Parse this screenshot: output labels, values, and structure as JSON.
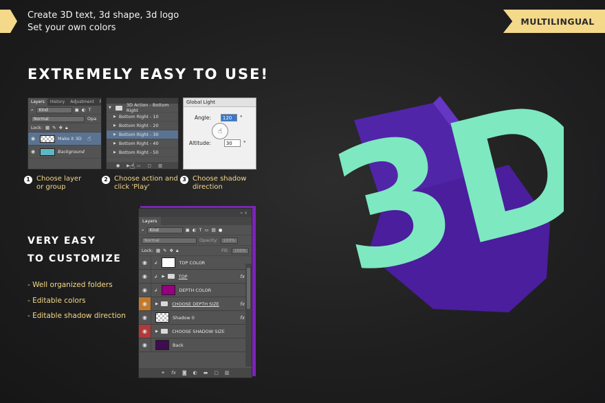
{
  "header": {
    "line1": "Create 3D text, 3d shape, 3d logo",
    "line2": "Set your own colors",
    "badge": "MULTILINGUAL"
  },
  "headline": "EXTREMELY EASY TO USE!",
  "panel_layers_small": {
    "tabs": [
      "Layers",
      "History",
      "Adjustment",
      "P"
    ],
    "kind": "Kind",
    "blend": "Normal",
    "opacity_label": "Opa",
    "lock_label": "Lock:",
    "layers": [
      "Make it 3D",
      "Background"
    ]
  },
  "panel_actions": {
    "folder": "3D Action - Bottom Right",
    "items": [
      "Bottom Right - 10",
      "Bottom Right - 20",
      "Bottom Right - 30",
      "Bottom Right - 40",
      "Bottom Right - 50"
    ]
  },
  "panel_global_light": {
    "title": "Global Light",
    "angle_label": "Angle:",
    "angle_value": "120",
    "altitude_label": "Altitude:",
    "altitude_value": "30",
    "degree": "°"
  },
  "steps": [
    {
      "num": "1",
      "line1": "Choose layer",
      "line2": "or group"
    },
    {
      "num": "2",
      "line1": "Choose action and",
      "line2": "click 'Play'"
    },
    {
      "num": "3",
      "line1": "Choose shadow",
      "line2": "direction"
    }
  ],
  "customize": {
    "line1": "VERY EASY",
    "line2": "TO CUSTOMIZE",
    "bullets": [
      "- Well organized folders",
      "- Editable colors",
      "- Editable shadow direction"
    ]
  },
  "layers_panel": {
    "tab": "Layers",
    "kind": "Kind",
    "blend": "Normal",
    "opacity_label": "Opacity:",
    "opacity_value": "100%",
    "lock_label": "Lock:",
    "fill_label": "Fill:",
    "fill_value": "100%",
    "fx": "fx",
    "layers": [
      "TOP COLOR",
      "TOP",
      "DEPTH COLOR",
      "CHOOSE DEPTH SIZE",
      "Shadow 0",
      "CHOOSE SHADOW SIZE",
      "Back"
    ]
  },
  "big_text": "3D",
  "colors": {
    "accent_yellow": "#f5d98a",
    "mint": "#7ee8c0",
    "purple": "#4d1f9c",
    "panel_purple": "#7b24b8"
  }
}
